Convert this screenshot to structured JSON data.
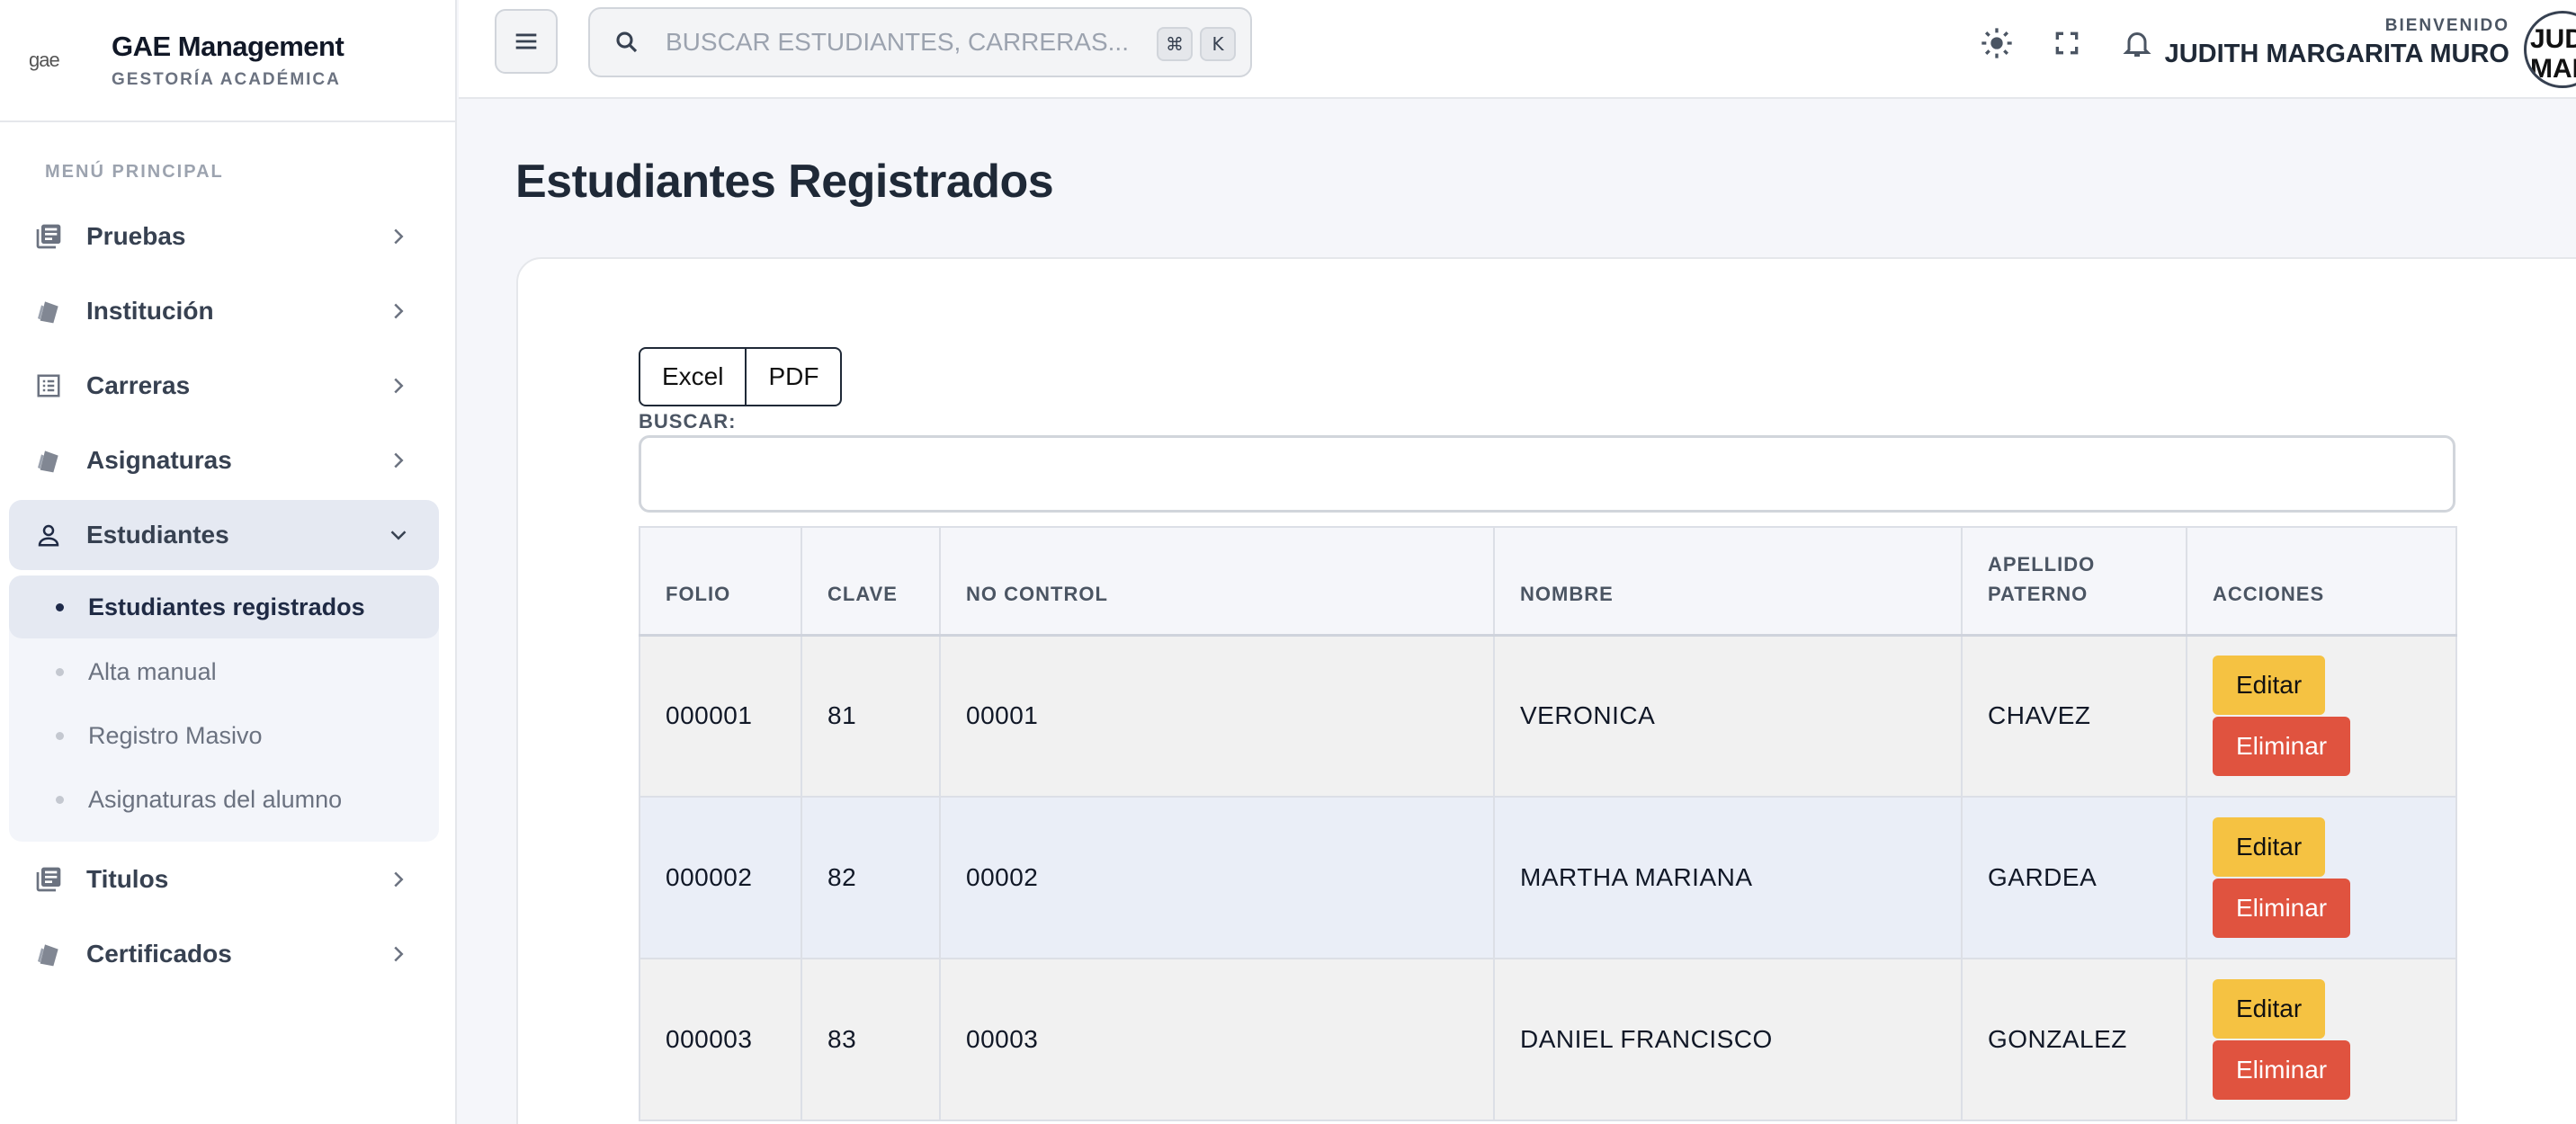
{
  "brand": {
    "logo_text": "gae",
    "title": "GAE Management",
    "subtitle": "GESTORÍA ACADÉMICA"
  },
  "sidebar": {
    "section_label": "MENÚ PRINCIPAL",
    "items": [
      {
        "label": "Pruebas",
        "icon": "books-icon"
      },
      {
        "label": "Institución",
        "icon": "tag-icon"
      },
      {
        "label": "Carreras",
        "icon": "list-icon"
      },
      {
        "label": "Asignaturas",
        "icon": "tag-icon"
      },
      {
        "label": "Estudiantes",
        "icon": "user-icon",
        "active": true
      },
      {
        "label": "Titulos",
        "icon": "books-icon"
      },
      {
        "label": "Certificados",
        "icon": "tag-icon"
      }
    ],
    "submenu": [
      {
        "label": "Estudiantes registrados",
        "active": true
      },
      {
        "label": "Alta manual"
      },
      {
        "label": "Registro Masivo"
      },
      {
        "label": "Asignaturas del alumno"
      }
    ]
  },
  "topbar": {
    "search_placeholder": "BUSCAR ESTUDIANTES, CARRERAS...",
    "shortcut_keys": [
      "⌘",
      "K"
    ],
    "welcome_label": "BIENVENIDO",
    "user_name": "JUDITH MARGARITA MURO",
    "avatar_text": "JUDITH MARGARITA MURO"
  },
  "main": {
    "title": "Estudiantes Registrados",
    "export_buttons": [
      "Excel",
      "PDF"
    ],
    "search_label": "BUSCAR:",
    "table": {
      "columns": [
        "FOLIO",
        "CLAVE",
        "NO CONTROL",
        "NOMBRE",
        "APELLIDO PATERNO",
        "ACCIONES"
      ],
      "rows": [
        {
          "folio": "000001",
          "clave": "81",
          "no_control": "00001",
          "nombre": "VERONICA",
          "apellido": "CHAVEZ"
        },
        {
          "folio": "000002",
          "clave": "82",
          "no_control": "00002",
          "nombre": "MARTHA MARIANA",
          "apellido": "GARDEA"
        },
        {
          "folio": "000003",
          "clave": "83",
          "no_control": "00003",
          "nombre": "DANIEL FRANCISCO",
          "apellido": "GONZALEZ"
        }
      ],
      "edit_label": "Editar",
      "delete_label": "Eliminar"
    }
  }
}
